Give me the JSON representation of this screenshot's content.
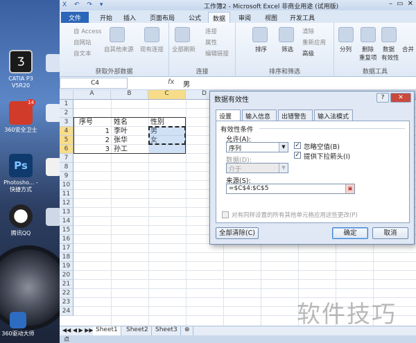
{
  "desktop": {
    "icons": [
      {
        "label": "CATIA P3 V5R20",
        "color": "#1a1a1a"
      },
      {
        "label": "360安全卫士",
        "color": "#d03b2a"
      },
      {
        "label": "Photosho... - 快捷方式",
        "color": "#0f3a6e"
      },
      {
        "label": "腾讯QQ",
        "color": "#e9e9e9"
      },
      {
        "label": "360驱动大师",
        "color": "#2d6cc0"
      }
    ],
    "badge": "14"
  },
  "titlebar": {
    "title": "工作簿2 - Microsoft Excel 非商业用途 (试用版)",
    "qat": "X ↶ ↷ ▾"
  },
  "tabs": {
    "file": "文件",
    "items": [
      "开始",
      "插入",
      "页面布局",
      "公式",
      "数据",
      "审阅",
      "视图",
      "开发工具"
    ],
    "active": "数据"
  },
  "ribbon": {
    "get_external": {
      "items": [
        "自 Access",
        "自网站",
        "自文本",
        "自其他来源",
        "现有连接"
      ],
      "label": "获取外部数据"
    },
    "connections": {
      "items": [
        "全部刷新",
        "连接",
        "属性",
        "编辑链接"
      ],
      "label": "连接"
    },
    "sort_filter": {
      "items": [
        "排序",
        "筛选",
        "清除",
        "重新应用",
        "高级"
      ],
      "label": "排序和筛选"
    },
    "tools": {
      "items": [
        "分列",
        "删除",
        "重复项",
        "数据",
        "有效性",
        "合并"
      ],
      "label": "数据工具"
    }
  },
  "formula_bar": {
    "name_box": "C4",
    "fx": "fx",
    "value": "男"
  },
  "sheet": {
    "columns": [
      "A",
      "B",
      "C",
      "D"
    ],
    "rows": [
      "1",
      "2",
      "3",
      "4",
      "5",
      "6",
      "7",
      "8",
      "9",
      "10",
      "11",
      "12",
      "13",
      "14",
      "15",
      "16",
      "17",
      "18",
      "19",
      "20",
      "21",
      "22",
      "23",
      "24"
    ],
    "cells": {
      "A3": "序号",
      "B3": "姓名",
      "C3": "性别",
      "A4": "1",
      "B4": "李叶",
      "C4": "男",
      "A5": "2",
      "B5": "张华",
      "C5": "女",
      "A6": "3",
      "B6": "孙工"
    },
    "tabs": [
      "Sheet1",
      "Sheet2",
      "Sheet3"
    ],
    "status": "点"
  },
  "dialog": {
    "title": "数据有效性",
    "help": "?",
    "close": "✕",
    "tabs": [
      "设置",
      "输入信息",
      "出错警告",
      "输入法模式"
    ],
    "section": "有效性条件",
    "allow_label": "允许(A):",
    "allow_value": "序列",
    "ignore_blank": "忽略空值(B)",
    "dropdown": "提供下拉箭头(I)",
    "data_label": "数据(D):",
    "data_value": "介于",
    "source_label": "来源(S):",
    "source_value": "=$C$4:$C$5",
    "apply_all": "对有同样设置的所有其他单元格应用这些更改(P)",
    "clear_all": "全部清除(C)",
    "ok": "确定",
    "cancel": "取消"
  },
  "watermark": "软件技巧"
}
